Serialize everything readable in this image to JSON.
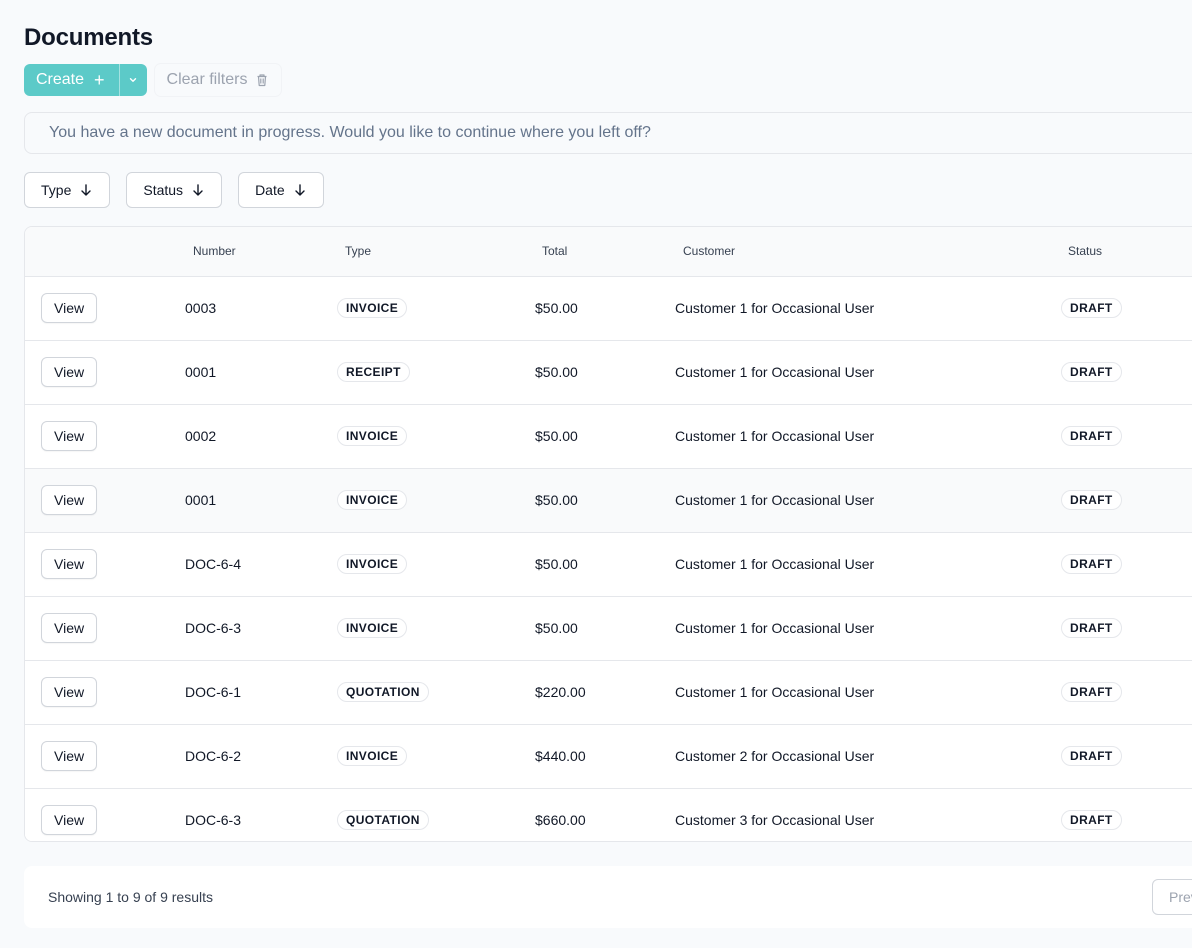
{
  "page": {
    "title": "Documents"
  },
  "toolbar": {
    "create_label": "Create",
    "create_icon": "plus-icon",
    "create_menu_icon": "chevron-down-icon",
    "clear_filters_label": "Clear filters",
    "clear_filters_icon": "trash-icon"
  },
  "banner": {
    "text": "You have a new document in progress. Would you like to continue where you left off?"
  },
  "filters": [
    {
      "label": "Type",
      "icon": "arrow-down-icon"
    },
    {
      "label": "Status",
      "icon": "arrow-down-icon"
    },
    {
      "label": "Date",
      "icon": "arrow-down-icon"
    }
  ],
  "table": {
    "columns": [
      "Number",
      "Type",
      "Total",
      "Customer",
      "Status"
    ],
    "view_label": "View",
    "rows": [
      {
        "number": "0003",
        "type": "INVOICE",
        "total": "$50.00",
        "customer": "Customer 1 for Occasional User",
        "status": "DRAFT"
      },
      {
        "number": "0001",
        "type": "RECEIPT",
        "total": "$50.00",
        "customer": "Customer 1 for Occasional User",
        "status": "DRAFT"
      },
      {
        "number": "0002",
        "type": "INVOICE",
        "total": "$50.00",
        "customer": "Customer 1 for Occasional User",
        "status": "DRAFT"
      },
      {
        "number": "0001",
        "type": "INVOICE",
        "total": "$50.00",
        "customer": "Customer 1 for Occasional User",
        "status": "DRAFT"
      },
      {
        "number": "DOC-6-4",
        "type": "INVOICE",
        "total": "$50.00",
        "customer": "Customer 1 for Occasional User",
        "status": "DRAFT"
      },
      {
        "number": "DOC-6-3",
        "type": "INVOICE",
        "total": "$50.00",
        "customer": "Customer 1 for Occasional User",
        "status": "DRAFT"
      },
      {
        "number": "DOC-6-1",
        "type": "QUOTATION",
        "total": "$220.00",
        "customer": "Customer 1 for Occasional User",
        "status": "DRAFT"
      },
      {
        "number": "DOC-6-2",
        "type": "INVOICE",
        "total": "$440.00",
        "customer": "Customer 2 for Occasional User",
        "status": "DRAFT"
      },
      {
        "number": "DOC-6-3",
        "type": "QUOTATION",
        "total": "$660.00",
        "customer": "Customer 3 for Occasional User",
        "status": "DRAFT"
      }
    ]
  },
  "pagination": {
    "results_text": "Showing 1 to 9 of 9 results",
    "prev_label": "Previous"
  }
}
